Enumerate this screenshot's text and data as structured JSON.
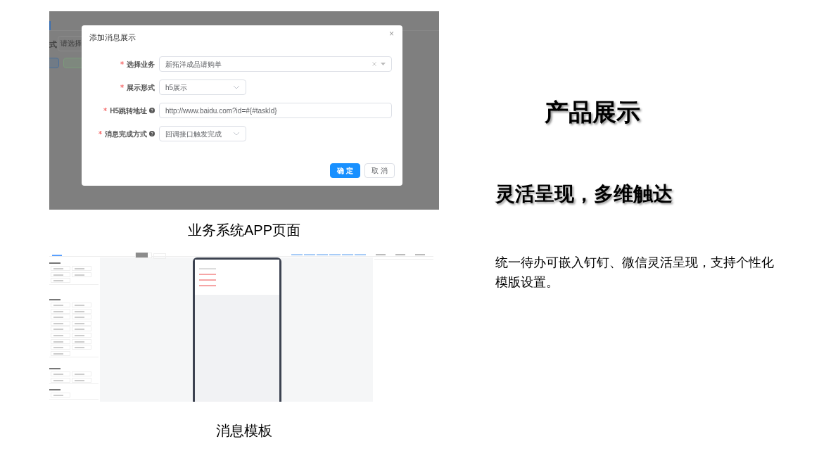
{
  "top_screenshot": {
    "background": {
      "label_fragment": "式",
      "select_placeholder": "请选择"
    },
    "dialog": {
      "title": "添加消息展示",
      "close": "×",
      "fields": [
        {
          "label": "选择业务",
          "required": true,
          "help": false,
          "kind": "select",
          "wide": true,
          "clearable": true,
          "value": "新拓洋成品请购单"
        },
        {
          "label": "展示形式",
          "required": true,
          "help": false,
          "kind": "select",
          "wide": false,
          "clearable": false,
          "value": "h5展示"
        },
        {
          "label": "H5跳转地址",
          "required": true,
          "help": true,
          "kind": "text",
          "wide": true,
          "value": "http://www.baidu.com?id=#{#taskId}"
        },
        {
          "label": "消息完成方式",
          "required": true,
          "help": true,
          "kind": "select",
          "wide": false,
          "clearable": false,
          "value": "回调接口触发完成"
        }
      ],
      "buttons": [
        {
          "label": "确 定",
          "primary": true
        },
        {
          "label": "取 消",
          "primary": false
        }
      ]
    },
    "caption": "业务系统APP页面"
  },
  "bottom_screenshot": {
    "caption": "消息模板"
  },
  "heading": "产品展示",
  "subheading": "灵活呈现，多维触达",
  "description": "统一待办可嵌入钉钉、微信灵活呈现，支持个性化模版设置。"
}
